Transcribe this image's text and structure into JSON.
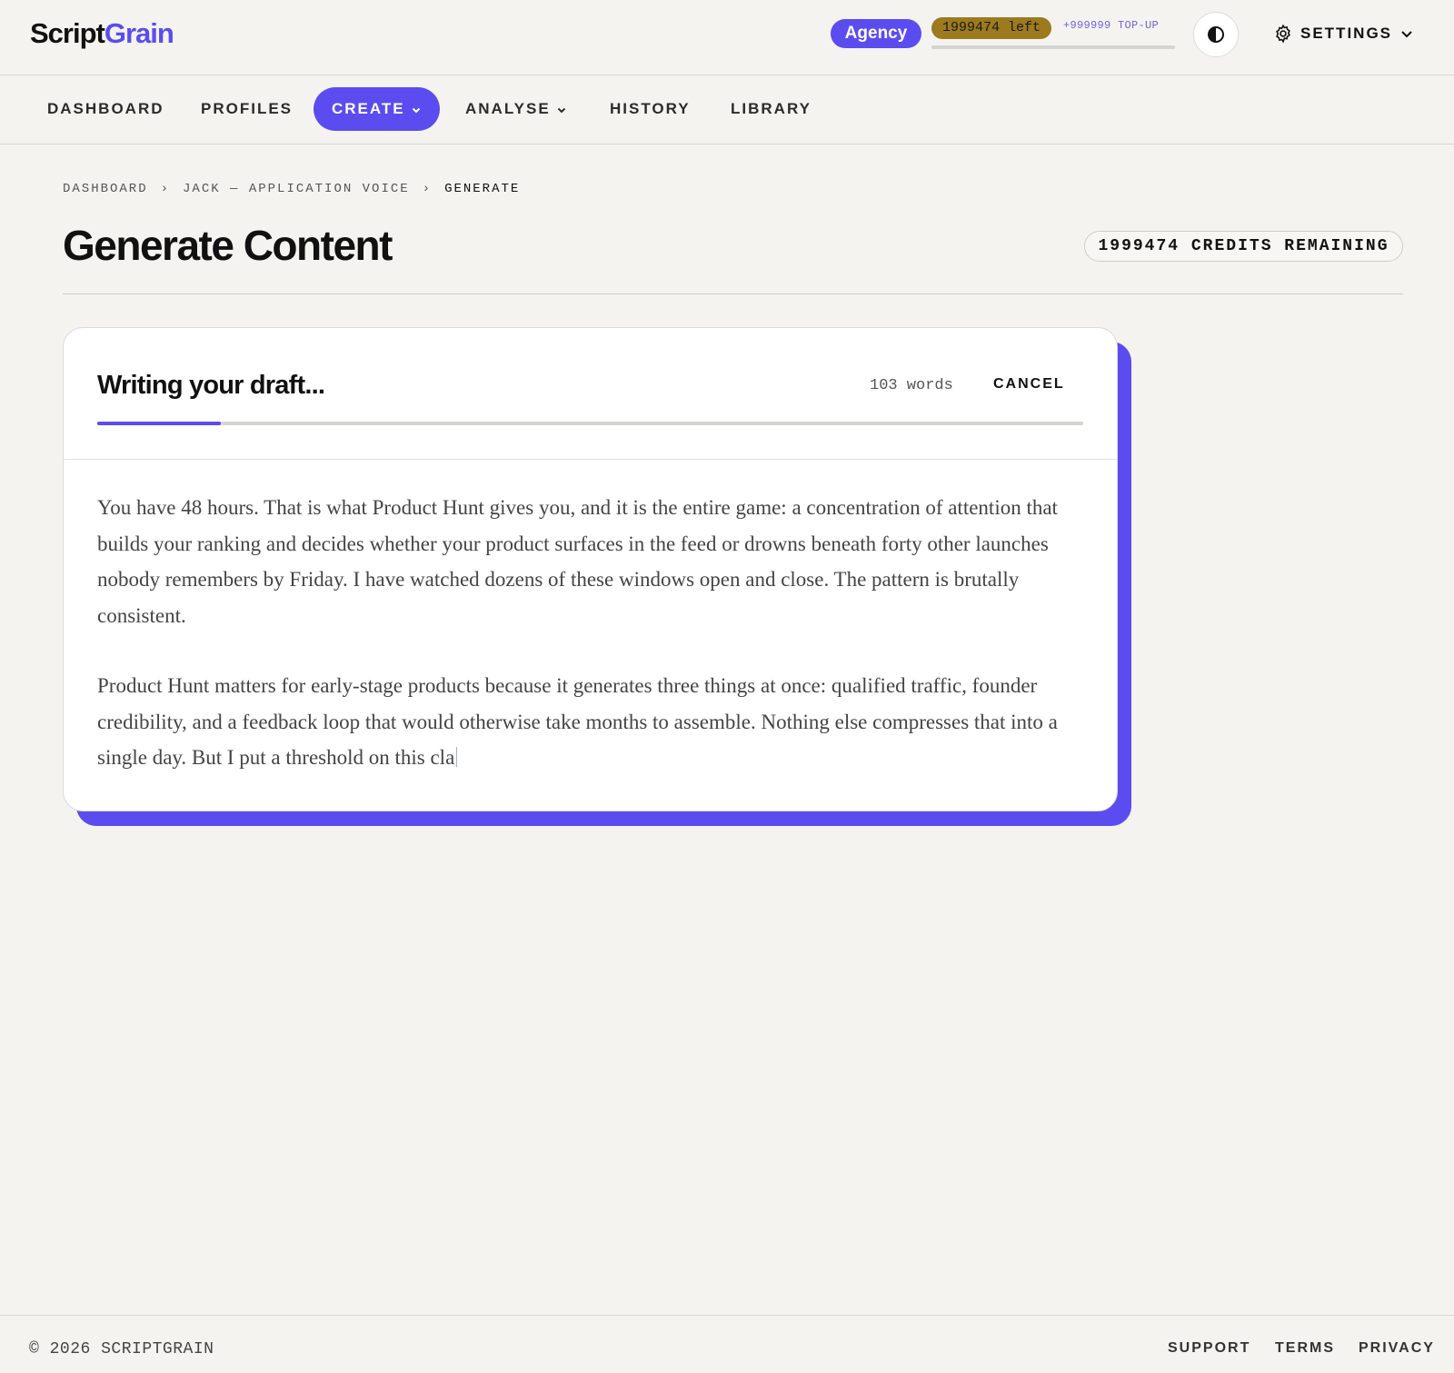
{
  "header": {
    "logo_part1": "Script",
    "logo_part2": "Grain",
    "plan_badge": "Agency",
    "credits_left": "1999474 left",
    "topup_label": "+999999 TOP-UP",
    "theme_icon": "contrast-icon",
    "settings_label": "SETTINGS"
  },
  "nav": {
    "items": [
      {
        "label": "DASHBOARD"
      },
      {
        "label": "PROFILES"
      },
      {
        "label": "CREATE",
        "active": true,
        "has_dropdown": true
      },
      {
        "label": "ANALYSE",
        "has_dropdown": true
      },
      {
        "label": "HISTORY"
      },
      {
        "label": "LIBRARY"
      }
    ]
  },
  "breadcrumb": {
    "items": [
      "DASHBOARD",
      "JACK — APPLICATION VOICE",
      "GENERATE"
    ],
    "separator": "›"
  },
  "page": {
    "title": "Generate Content",
    "credits_remaining": "1999474 CREDITS REMAINING"
  },
  "draft": {
    "title": "Writing your draft...",
    "word_count": "103 words",
    "cancel_label": "CANCEL",
    "progress": 0.125,
    "paragraphs": [
      "You have 48 hours. That is what Product Hunt gives you, and it is the entire game: a concentration of attention that builds your ranking and decides whether your product surfaces in the feed or drowns beneath forty other launches nobody remembers by Friday. I have watched dozens of these windows open and close. The pattern is brutally consistent.",
      "Product Hunt matters for early-stage products because it generates three things at once: qualified traffic, founder credibility, and a feedback loop that would otherwise take months to assemble. Nothing else compresses that into a single day. But I put a threshold on this cla"
    ]
  },
  "footer": {
    "copyright": "© 2026 SCRIPTGRAIN",
    "links": [
      "SUPPORT",
      "TERMS",
      "PRIVACY"
    ]
  },
  "colors": {
    "accent": "#5b4cf0",
    "credits_pill": "#9c7a1d",
    "background": "#f4f3f0"
  }
}
